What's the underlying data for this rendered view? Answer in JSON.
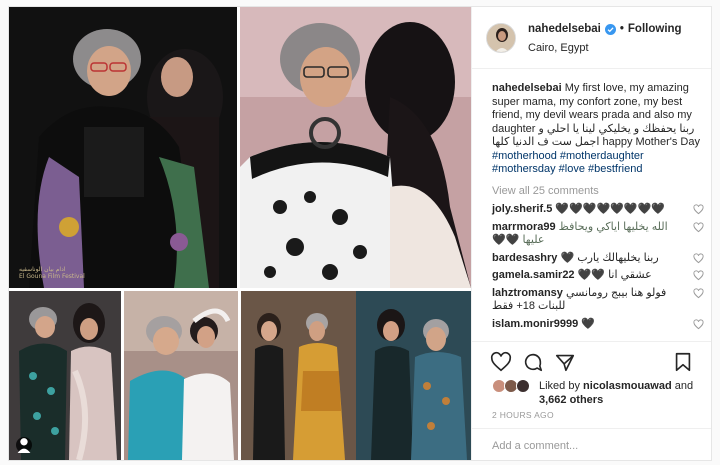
{
  "header": {
    "username": "nahedelsebai",
    "follow_status": "Following",
    "dot": "•",
    "location": "Cairo, Egypt"
  },
  "caption": {
    "author": "nahedelsebai",
    "text_en": "My first love, my amazing super mama, my confort zone, my best friend, my devil wears prada and also my daughter",
    "text_ar": "ربنا يحفظك و يخليكي لينا يا احلي و اجمل ست ف الدنيا كلها",
    "text_end": "happy Mother's Day",
    "hashtags": [
      "#motherhood",
      "#motherdaughter",
      "#mothersday",
      "#love",
      "#bestfriend"
    ]
  },
  "comments": {
    "view_all": "View all 25 comments",
    "items": [
      {
        "user": "joly.sherif.5",
        "text": "🖤🖤🖤🖤🖤🖤🖤🖤"
      },
      {
        "user": "marrmora99",
        "text": "الله يخليها اياكي ويحافظ عليها 🖤🖤"
      },
      {
        "user": "bardesashry",
        "text": "ربنا يخليهالك يارب 🖤"
      },
      {
        "user": "gamela.samir22",
        "text": "عشقي انا 🖤🖤"
      },
      {
        "user": "lahztromansy",
        "text": "فولو هنا بيبج رومانسي للبنات 18+ فقط"
      },
      {
        "user": "islam.monir9999",
        "text": "🖤"
      }
    ]
  },
  "likes": {
    "prefix": "Liked by",
    "user": "nicolasmouawad",
    "mid": "and",
    "count": "3,662 others"
  },
  "time": "2 HOURS AGO",
  "add_comment": {
    "placeholder": "Add a comment..."
  },
  "watermark": {
    "line1": "ادام بيان الوناسفيه",
    "line2": "El Gouna Film Festival"
  },
  "colors": {
    "link": "#003569",
    "muted": "#999999",
    "border": "#efefef",
    "verified": "#3897f0"
  },
  "icons": {
    "verified": "verified-badge-icon",
    "heart": "heart-icon",
    "comment": "comment-bubble-icon",
    "share": "share-icon",
    "save": "bookmark-icon",
    "user_tag": "user-tag-icon"
  }
}
